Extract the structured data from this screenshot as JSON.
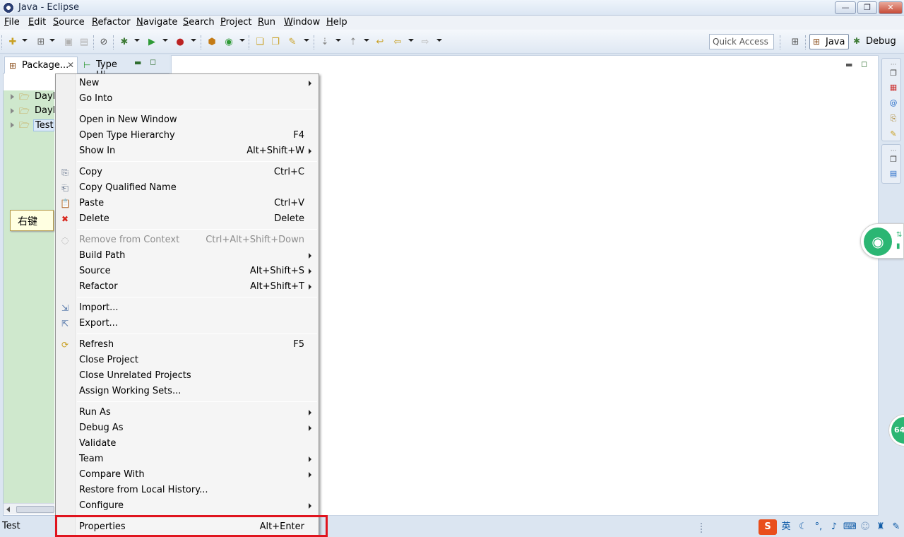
{
  "window": {
    "title": "Java - Eclipse",
    "controls": {
      "minimize": "—",
      "maximize": "❐",
      "close": "✕"
    }
  },
  "menubar": [
    "File",
    "Edit",
    "Source",
    "Refactor",
    "Navigate",
    "Search",
    "Project",
    "Run",
    "Window",
    "Help"
  ],
  "toolbar": {
    "quick_access": "Quick Access",
    "perspectives": [
      "Java",
      "Debug"
    ]
  },
  "left_view": {
    "tabs": [
      {
        "label": "Package...",
        "icon": "package-explorer-icon"
      },
      {
        "label": "Type Hi.",
        "icon": "type-hierarchy-icon"
      }
    ],
    "tree": [
      {
        "label": "DayP",
        "selected": false
      },
      {
        "label": "DayP",
        "selected": false
      },
      {
        "label": "Test",
        "selected": true
      }
    ]
  },
  "callout": "右键",
  "context_menu": {
    "groups": [
      [
        {
          "label": "New",
          "shortcut": "",
          "submenu": true,
          "icon": ""
        },
        {
          "label": "Go Into",
          "shortcut": "",
          "submenu": false,
          "icon": ""
        }
      ],
      [
        {
          "label": "Open in New Window",
          "shortcut": "",
          "submenu": false,
          "icon": ""
        },
        {
          "label": "Open Type Hierarchy",
          "shortcut": "F4",
          "submenu": false,
          "icon": ""
        },
        {
          "label": "Show In",
          "shortcut": "Alt+Shift+W",
          "submenu": true,
          "icon": ""
        }
      ],
      [
        {
          "label": "Copy",
          "shortcut": "Ctrl+C",
          "submenu": false,
          "icon": "copy-icon"
        },
        {
          "label": "Copy Qualified Name",
          "shortcut": "",
          "submenu": false,
          "icon": "copy-qualified-icon"
        },
        {
          "label": "Paste",
          "shortcut": "Ctrl+V",
          "submenu": false,
          "icon": "paste-icon"
        },
        {
          "label": "Delete",
          "shortcut": "Delete",
          "submenu": false,
          "icon": "delete-icon"
        }
      ],
      [
        {
          "label": "Remove from Context",
          "shortcut": "Ctrl+Alt+Shift+Down",
          "submenu": false,
          "icon": "remove-context-icon",
          "disabled": true
        },
        {
          "label": "Build Path",
          "shortcut": "",
          "submenu": true,
          "icon": ""
        },
        {
          "label": "Source",
          "shortcut": "Alt+Shift+S",
          "submenu": true,
          "icon": ""
        },
        {
          "label": "Refactor",
          "shortcut": "Alt+Shift+T",
          "submenu": true,
          "icon": ""
        }
      ],
      [
        {
          "label": "Import...",
          "shortcut": "",
          "submenu": false,
          "icon": "import-icon"
        },
        {
          "label": "Export...",
          "shortcut": "",
          "submenu": false,
          "icon": "export-icon"
        }
      ],
      [
        {
          "label": "Refresh",
          "shortcut": "F5",
          "submenu": false,
          "icon": "refresh-icon"
        },
        {
          "label": "Close Project",
          "shortcut": "",
          "submenu": false,
          "icon": ""
        },
        {
          "label": "Close Unrelated Projects",
          "shortcut": "",
          "submenu": false,
          "icon": ""
        },
        {
          "label": "Assign Working Sets...",
          "shortcut": "",
          "submenu": false,
          "icon": ""
        }
      ],
      [
        {
          "label": "Run As",
          "shortcut": "",
          "submenu": true,
          "icon": ""
        },
        {
          "label": "Debug As",
          "shortcut": "",
          "submenu": true,
          "icon": ""
        },
        {
          "label": "Validate",
          "shortcut": "",
          "submenu": false,
          "icon": ""
        },
        {
          "label": "Team",
          "shortcut": "",
          "submenu": true,
          "icon": ""
        },
        {
          "label": "Compare With",
          "shortcut": "",
          "submenu": true,
          "icon": ""
        },
        {
          "label": "Restore from Local History...",
          "shortcut": "",
          "submenu": false,
          "icon": ""
        },
        {
          "label": "Configure",
          "shortcut": "",
          "submenu": true,
          "icon": ""
        }
      ],
      [
        {
          "label": "Properties",
          "shortcut": "Alt+Enter",
          "submenu": false,
          "icon": "",
          "highlighted": true
        }
      ]
    ]
  },
  "statusbar": {
    "text": "Test",
    "ime_logo": "S",
    "ime_mode": "英"
  },
  "widgets": {
    "green_badge": "64"
  },
  "colors": {
    "highlight_border": "#e0141e",
    "tree_background": "#cfe8cd",
    "callout_background": "#ffffe1",
    "wifi_green": "#2bb673"
  }
}
